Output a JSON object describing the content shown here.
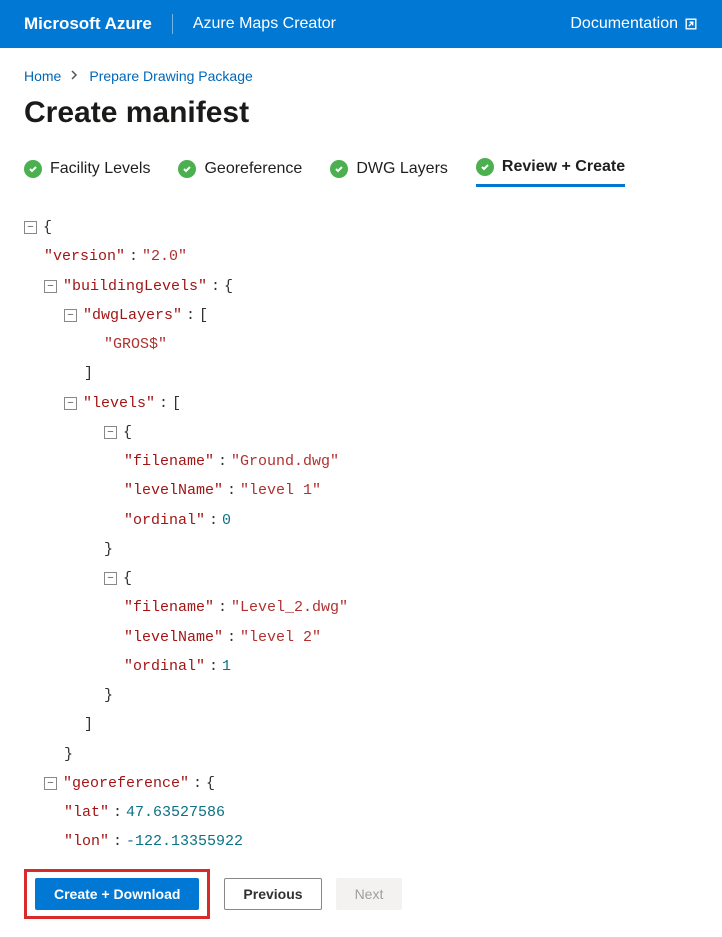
{
  "header": {
    "brand": "Microsoft Azure",
    "product": "Azure Maps Creator",
    "doc_link": "Documentation"
  },
  "breadcrumb": {
    "home": "Home",
    "page": "Prepare Drawing Package"
  },
  "title": "Create manifest",
  "steps": {
    "s1": "Facility Levels",
    "s2": "Georeference",
    "s3": "DWG Layers",
    "s4": "Review + Create"
  },
  "manifest": {
    "version_key": "\"version\"",
    "version_val": "\"2.0\"",
    "buildingLevels_key": "\"buildingLevels\"",
    "dwgLayers_key": "\"dwgLayers\"",
    "dwgLayers_val0": "\"GROS$\"",
    "levels_key": "\"levels\"",
    "filename_key": "\"filename\"",
    "levelName_key": "\"levelName\"",
    "ordinal_key": "\"ordinal\"",
    "lvl0_filename": "\"Ground.dwg\"",
    "lvl0_levelName": "\"level 1\"",
    "lvl0_ordinal": "0",
    "lvl1_filename": "\"Level_2.dwg\"",
    "lvl1_levelName": "\"level 2\"",
    "lvl1_ordinal": "1",
    "georeference_key": "\"georeference\"",
    "lat_key": "\"lat\"",
    "lat_val": "47.63527586",
    "lon_key": "\"lon\"",
    "lon_val": "-122.13355922"
  },
  "buttons": {
    "create": "Create + Download",
    "prev": "Previous",
    "next": "Next"
  }
}
